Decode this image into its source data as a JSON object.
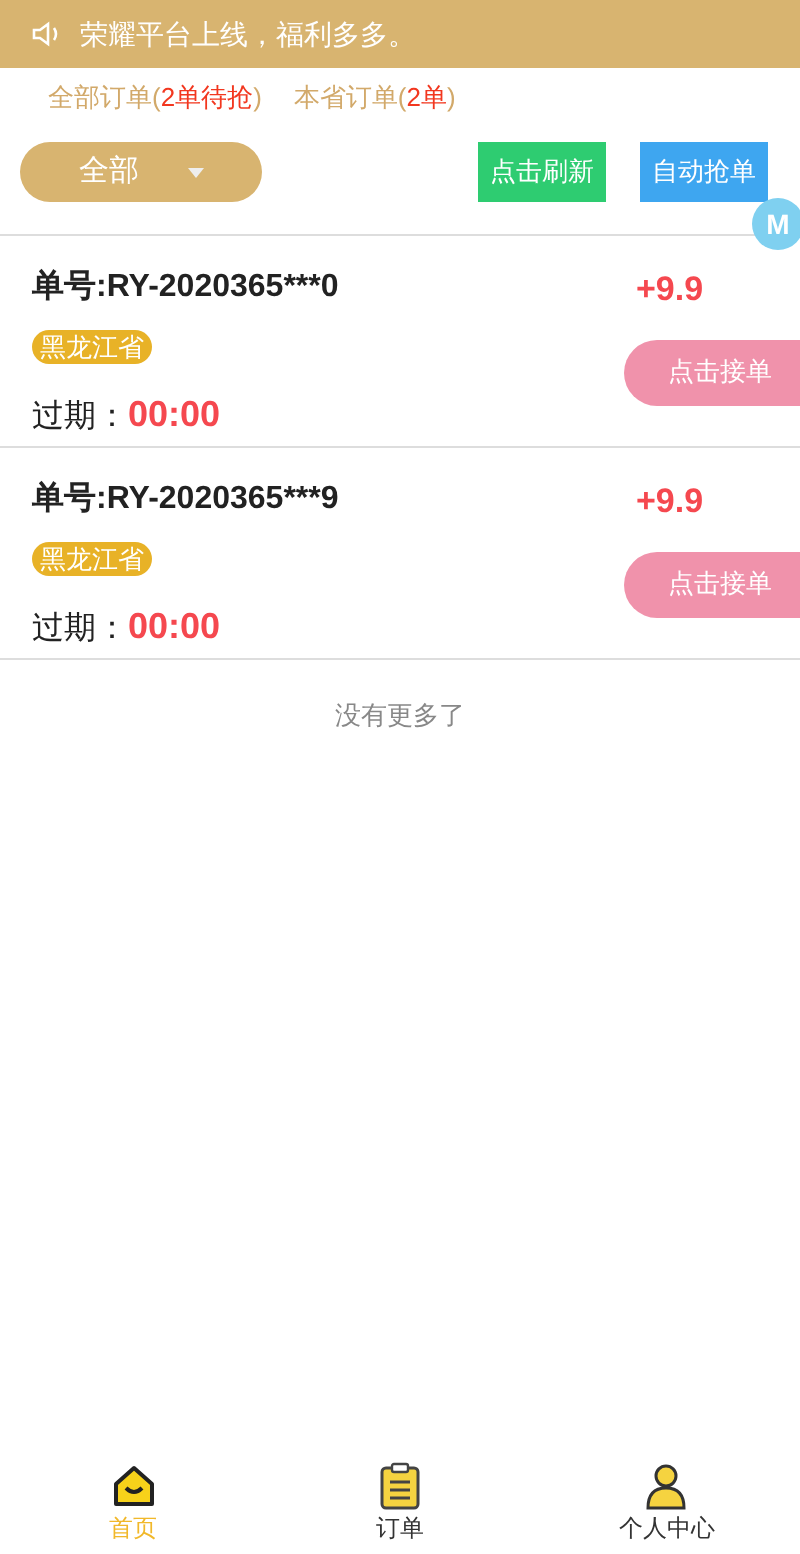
{
  "notice": {
    "text": "荣耀平台上线，福利多多。"
  },
  "tabs": [
    {
      "label": "全部订单(",
      "count": "2单待抢",
      "close": ")"
    },
    {
      "label": "本省订单(",
      "count": "2单",
      "close": ")"
    }
  ],
  "filter": {
    "value": "全部"
  },
  "buttons": [
    {
      "label": "点击刷新",
      "kind": "refresh"
    },
    {
      "label": "自动抢单",
      "kind": "auto"
    }
  ],
  "float_badge": "M",
  "orders": [
    {
      "number": "单号:RY-2020365***0",
      "province": "黑龙江省",
      "expiry_label": "过期：",
      "expiry": "00:00",
      "amount": "+9.9",
      "action": "点击接单"
    },
    {
      "number": "单号:RY-2020365***9",
      "province": "黑龙江省",
      "expiry_label": "过期：",
      "expiry": "00:00",
      "amount": "+9.9",
      "action": "点击接单"
    }
  ],
  "end_text": "没有更多了",
  "nav": [
    {
      "label": "首页",
      "kind": "home",
      "selected": true
    },
    {
      "label": "订单",
      "kind": "orders",
      "selected": false
    },
    {
      "label": "个人中心",
      "kind": "profile",
      "selected": false
    }
  ]
}
